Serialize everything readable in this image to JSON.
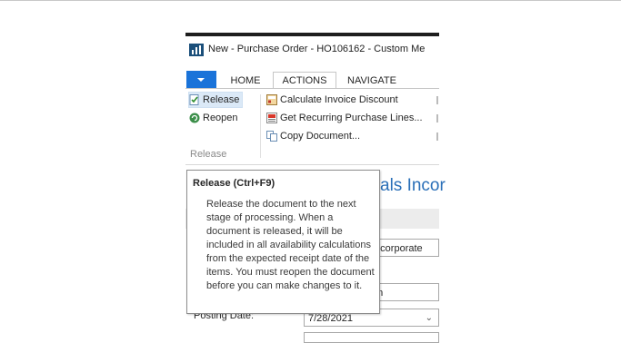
{
  "window": {
    "title": "New - Purchase Order - HO106162 - Custom Me"
  },
  "ribbon": {
    "tabs": [
      {
        "label": "HOME"
      },
      {
        "label": "ACTIONS"
      },
      {
        "label": "NAVIGATE"
      }
    ],
    "buttons": {
      "release": "Release",
      "reopen": "Reopen",
      "calc_invoice_discount": "Calculate Invoice Discount",
      "get_recurring": "Get Recurring Purchase Lines...",
      "copy_document": "Copy Document..."
    },
    "group_label": "Release"
  },
  "page": {
    "title_partial": "als Incor",
    "vendor_name_partial": "Incorporate",
    "contact_partial": "on",
    "posting_date_label": "Posting Date:",
    "posting_date_value": "7/28/2021"
  },
  "tooltip": {
    "title": "Release (Ctrl+F9)",
    "body": "Release the document to the next stage of processing. When a document is released, it will be included in all availability calculations from the expected receipt date of the items. You must reopen the document before you can make changes to it."
  },
  "colors": {
    "accent": "#1a73d9",
    "link": "#2a6fb8"
  }
}
